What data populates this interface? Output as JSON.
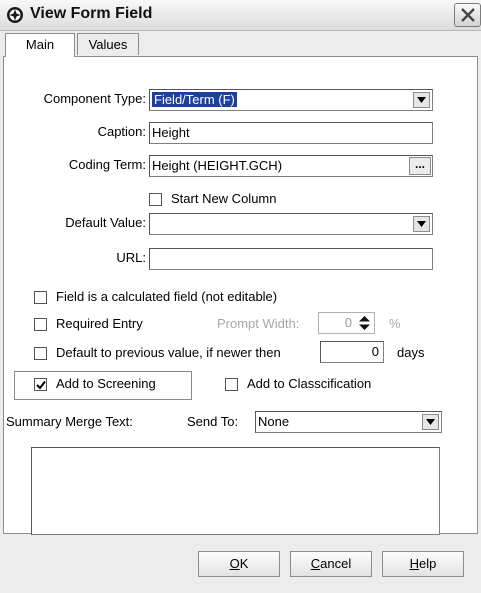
{
  "window": {
    "title": "View Form Field"
  },
  "tabs": [
    {
      "label": "Main"
    },
    {
      "label": "Values"
    }
  ],
  "form": {
    "component_type_label": "Component Type:",
    "component_type_value": "Field/Term (F)",
    "caption_label": "Caption:",
    "caption_value": "Height",
    "coding_term_label": "Coding Term:",
    "coding_term_value": "Height (HEIGHT.GCH)",
    "ellipsis_label": "...",
    "start_new_column_label": "Start New Column",
    "default_value_label": "Default Value:",
    "default_value": "",
    "url_label": "URL:",
    "url_value": "",
    "calculated_label": "Field is a calculated field (not editable)",
    "required_label": "Required Entry",
    "prompt_width_label": "Prompt Width:",
    "prompt_width_value": "0",
    "percent_label": "%",
    "default_prev_label": "Default to previous value, if newer then",
    "default_prev_days_value": "0",
    "days_label": "days",
    "add_screening_label": "Add to Screening",
    "add_screening_checked": true,
    "add_classification_label": "Add to Classcification",
    "summary_merge_label": "Summary Merge Text:",
    "send_to_label": "Send To:",
    "send_to_value": "None"
  },
  "buttons": {
    "ok": "OK",
    "cancel": "Cancel",
    "help": "Help"
  },
  "icons": {
    "app": "app-globe-icon",
    "close": "close-icon",
    "dropdown": "chevron-down-icon"
  }
}
